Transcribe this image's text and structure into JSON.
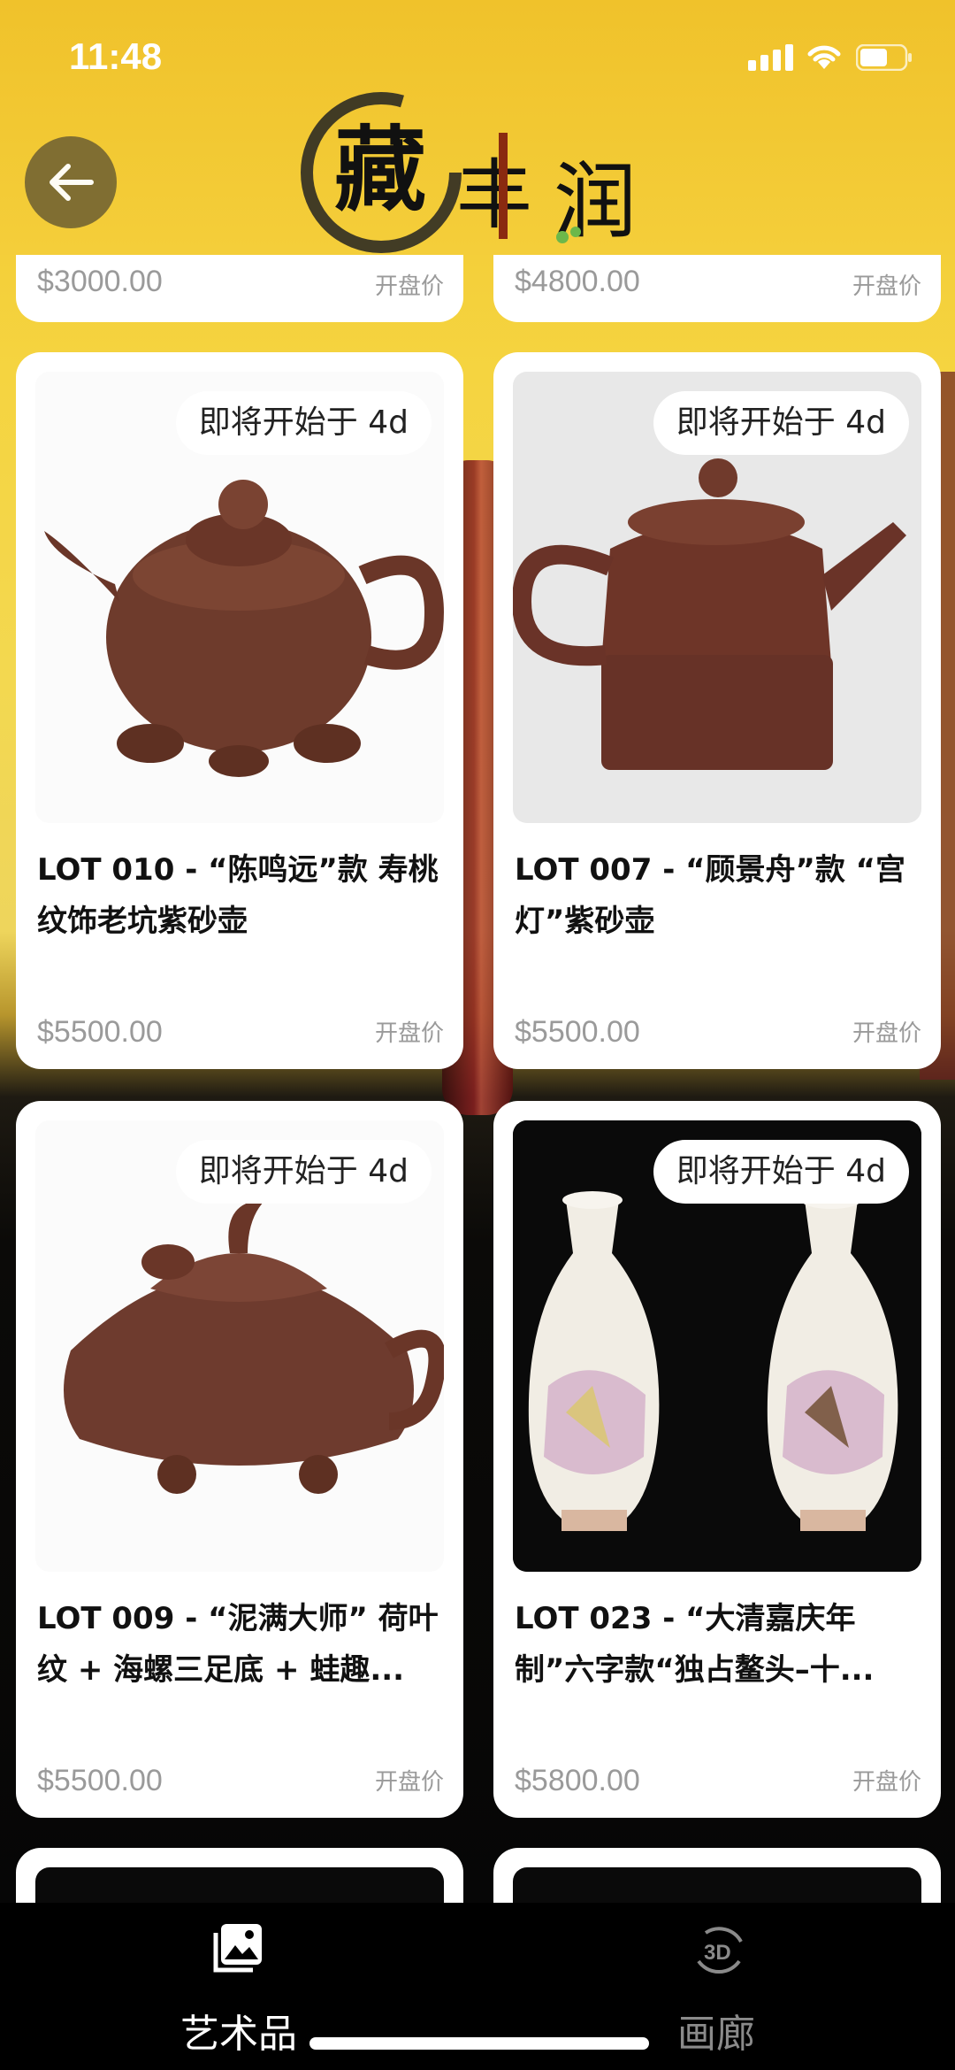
{
  "status_bar": {
    "time": "11:48"
  },
  "header": {
    "logo_text": "藏丰润"
  },
  "partial_top_cards": [
    {
      "price": "$3000.00",
      "price_label": "开盘价"
    },
    {
      "price": "$4800.00",
      "price_label": "开盘价"
    }
  ],
  "cards": [
    {
      "badge": "即将开始于 4d",
      "title_line1": "LOT 010 - “陈鸣远”款 寿桃",
      "title_line2": "纹饰老坑紫砂壶",
      "price": "$5500.00",
      "price_label": "开盘价"
    },
    {
      "badge": "即将开始于 4d",
      "title_line1": "LOT 007 - “顾景舟”款 “宫",
      "title_line2": "灯”紫砂壶",
      "price": "$5500.00",
      "price_label": "开盘价"
    },
    {
      "badge": "即将开始于 4d",
      "title_line1": "LOT 009 - “泥满大师” 荷叶",
      "title_line2": "纹 + 海螺三足底 + 蛙趣...",
      "price": "$5500.00",
      "price_label": "开盘价"
    },
    {
      "badge": "即将开始于 4d",
      "title_line1": "LOT 023 - “大清嘉庆年",
      "title_line2": "制”六字款“独占鳌头–十...",
      "price": "$5800.00",
      "price_label": "开盘价"
    }
  ],
  "tabbar": {
    "tabs": [
      {
        "label": "艺术品",
        "icon": "image-gallery-icon",
        "active": true
      },
      {
        "label": "画廊",
        "icon": "3d-rotate-icon",
        "active": false
      }
    ],
    "icon_3d_text": "3D"
  },
  "colors": {
    "accent_yellow": "#f5d440",
    "tab_bg": "#000000",
    "price_gray": "#9a9a9a"
  }
}
